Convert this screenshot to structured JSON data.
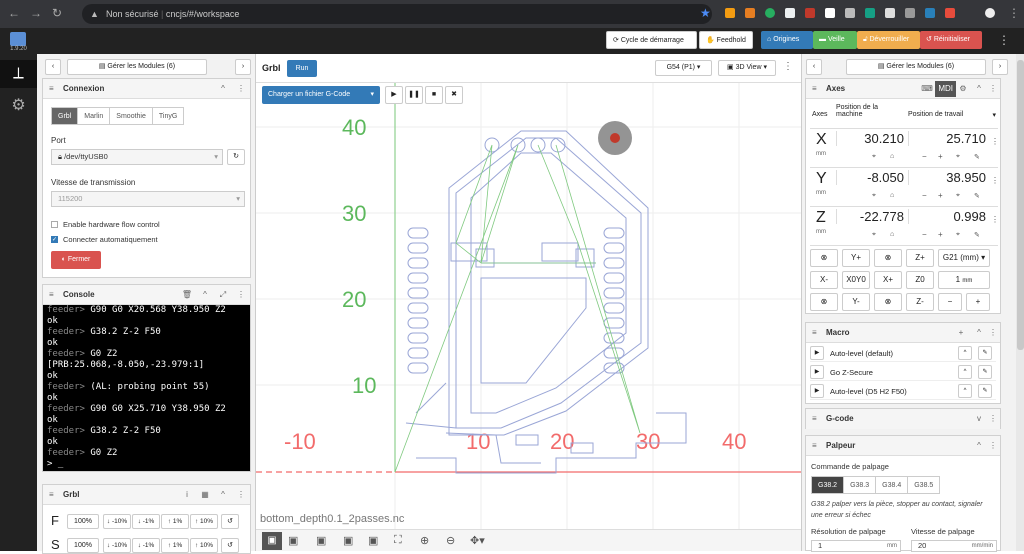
{
  "browser": {
    "url_security": "Non sécurisé",
    "url": "cncjs/#/workspace"
  },
  "app": {
    "version": "1.9.20"
  },
  "topbar": {
    "startup": "Cycle de démarrage",
    "feedhold": "Feedhold",
    "origins": "Origines",
    "sleep": "Veille",
    "unlock": "Déverrouiller",
    "reset": "Réinitialiser"
  },
  "left": {
    "modules": "Gérer les Modules (6)",
    "connection": {
      "title": "Connexion",
      "tabs": [
        "Grbl",
        "Marlin",
        "Smoothie",
        "TinyG"
      ],
      "port_label": "Port",
      "port": "/dev/ttyUSB0",
      "baud_label": "Vitesse de transmission",
      "baud": "115200",
      "flow": "Enable hardware flow control",
      "auto": "Connecter automatiquement",
      "close": "Fermer"
    },
    "console": {
      "title": "Console",
      "lines": [
        {
          "p": "feeder> ",
          "t": "G90 G0 X20.568 Y38.950 Z2"
        },
        {
          "p": "",
          "t": "ok"
        },
        {
          "p": "feeder> ",
          "t": "G38.2 Z-2 F50"
        },
        {
          "p": "",
          "t": "ok"
        },
        {
          "p": "feeder> ",
          "t": "G0 Z2"
        },
        {
          "p": "",
          "t": "[PRB:25.068,-8.050,-23.979:1]"
        },
        {
          "p": "",
          "t": "ok"
        },
        {
          "p": "feeder> ",
          "t": "(AL: probing point 55)"
        },
        {
          "p": "",
          "t": "ok"
        },
        {
          "p": "feeder> ",
          "t": "G90 G0 X25.710 Y38.950 Z2"
        },
        {
          "p": "",
          "t": "ok"
        },
        {
          "p": "feeder> ",
          "t": "G38.2 Z-2 F50"
        },
        {
          "p": "",
          "t": "ok"
        },
        {
          "p": "feeder> ",
          "t": "G0 Z2"
        },
        {
          "p": "",
          "t": "> _"
        }
      ]
    },
    "grbl": {
      "title": "Grbl",
      "rows": [
        {
          "k": "F",
          "v": "100%",
          "b": [
            "-10%",
            "-1%",
            "1%",
            "10%"
          ]
        },
        {
          "k": "S",
          "v": "100%",
          "b": [
            "-10%",
            "-1%",
            "1%",
            "10%"
          ]
        }
      ]
    }
  },
  "center": {
    "title": "Grbl",
    "run": "Run",
    "wcs": "G54 (P1)",
    "view": "3D View",
    "load": "Charger un fichier G-Code",
    "filename": "bottom_depth0.1_2passes.nc",
    "axis_y": [
      "40",
      "30",
      "20",
      "10"
    ],
    "axis_x": [
      "-10",
      "10",
      "20",
      "30",
      "40"
    ]
  },
  "right": {
    "modules": "Gérer les Modules (6)",
    "axes": {
      "title": "Axes",
      "mdi": "MDI",
      "h_axis": "Axes",
      "h_machine": "Position de la machine",
      "h_work": "Position de travail",
      "rows": [
        {
          "a": "X",
          "m": "30.210",
          "w": "25.710"
        },
        {
          "a": "Y",
          "m": "-8.050",
          "w": "38.950"
        },
        {
          "a": "Z",
          "m": "-22.778",
          "w": "0.998"
        }
      ],
      "unit": "mm",
      "jog": [
        "Y+",
        "Z+",
        "G21 (mm)",
        "X-",
        "X0Y0",
        "X+",
        "Z0",
        "1",
        "Y-",
        "Z-",
        "−",
        "+"
      ],
      "step_unit": "mm"
    },
    "macro": {
      "title": "Macro",
      "items": [
        "Auto-level (default)",
        "Go Z-Secure",
        "Auto-level (D5 H2 F50)"
      ]
    },
    "gcode": {
      "title": "G-code"
    },
    "probe": {
      "title": "Palpeur",
      "cmd_label": "Commande de palpage",
      "tabs": [
        "G38.2",
        "G38.3",
        "G38.4",
        "G38.5"
      ],
      "desc": "G38.2 palper vers la pièce, stopper au contact, signaler une erreur si échec",
      "res_label": "Résolution de palpage",
      "speed_label": "Vitesse de palpage",
      "res": "1",
      "res_unit": "mm",
      "speed": "20",
      "speed_unit": "mm/min"
    }
  }
}
